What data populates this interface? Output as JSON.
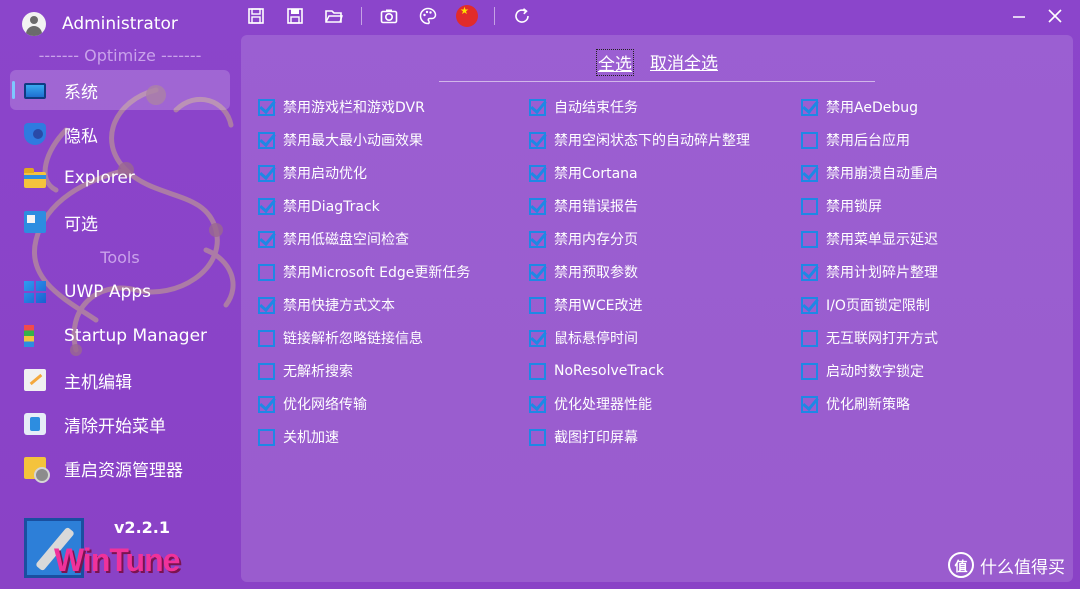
{
  "user": {
    "name": "Administrator"
  },
  "sidebar": {
    "optimize_title": "------- Optimize -------",
    "tools_title": "Tools",
    "items": [
      {
        "label": "系统",
        "icon": "monitor-icon",
        "active": true
      },
      {
        "label": "隐私",
        "icon": "shield-icon"
      },
      {
        "label": "Explorer",
        "icon": "folder-icon"
      },
      {
        "label": "可选",
        "icon": "control-panel-icon"
      },
      {
        "label": "UWP Apps",
        "icon": "windows-icon"
      },
      {
        "label": "Startup Manager",
        "icon": "startup-icon"
      },
      {
        "label": "主机编辑",
        "icon": "edit-icon"
      },
      {
        "label": "清除开始菜单",
        "icon": "clear-start-menu-icon"
      },
      {
        "label": "重启资源管理器",
        "icon": "restart-explorer-icon"
      }
    ]
  },
  "logo": {
    "text": "WinTune"
  },
  "version": "v2.2.1",
  "toolbar": {
    "icons": [
      "save-icon",
      "save-as-icon",
      "open-folder-icon",
      "camera-icon",
      "palette-icon",
      "china-flag-icon",
      "refresh-icon"
    ]
  },
  "selection": {
    "select_all": "全选",
    "deselect_all": "取消全选"
  },
  "options": {
    "col1": [
      {
        "label": "禁用游戏栏和游戏DVR",
        "checked": true
      },
      {
        "label": "禁用最大最小动画效果",
        "checked": true
      },
      {
        "label": "禁用启动优化",
        "checked": true
      },
      {
        "label": "禁用DiagTrack",
        "checked": true
      },
      {
        "label": "禁用低磁盘空间检查",
        "checked": true
      },
      {
        "label": "禁用Microsoft Edge更新任务",
        "checked": false
      },
      {
        "label": "禁用快捷方式文本",
        "checked": true
      },
      {
        "label": "链接解析忽略链接信息",
        "checked": false
      },
      {
        "label": "无解析搜索",
        "checked": false
      },
      {
        "label": "优化网络传输",
        "checked": true
      },
      {
        "label": "关机加速",
        "checked": false
      }
    ],
    "col2": [
      {
        "label": "自动结束任务",
        "checked": true
      },
      {
        "label": "禁用空闲状态下的自动碎片整理",
        "checked": true
      },
      {
        "label": "禁用Cortana",
        "checked": true
      },
      {
        "label": "禁用错误报告",
        "checked": true
      },
      {
        "label": "禁用内存分页",
        "checked": true
      },
      {
        "label": "禁用预取参数",
        "checked": true
      },
      {
        "label": "禁用WCE改进",
        "checked": false
      },
      {
        "label": "鼠标悬停时间",
        "checked": true
      },
      {
        "label": "NoResolveTrack",
        "checked": false
      },
      {
        "label": "优化处理器性能",
        "checked": true
      },
      {
        "label": "截图打印屏幕",
        "checked": false
      }
    ],
    "col3": [
      {
        "label": "禁用AeDebug",
        "checked": true
      },
      {
        "label": "禁用后台应用",
        "checked": false
      },
      {
        "label": "禁用崩溃自动重启",
        "checked": true
      },
      {
        "label": "禁用锁屏",
        "checked": false
      },
      {
        "label": "禁用菜单显示延迟",
        "checked": false
      },
      {
        "label": "禁用计划碎片整理",
        "checked": true
      },
      {
        "label": "I/O页面锁定限制",
        "checked": true
      },
      {
        "label": "无互联网打开方式",
        "checked": false
      },
      {
        "label": "启动时数字锁定",
        "checked": false
      },
      {
        "label": "优化刷新策略",
        "checked": true
      }
    ]
  },
  "watermark": {
    "badge": "值",
    "text": "什么值得买"
  }
}
